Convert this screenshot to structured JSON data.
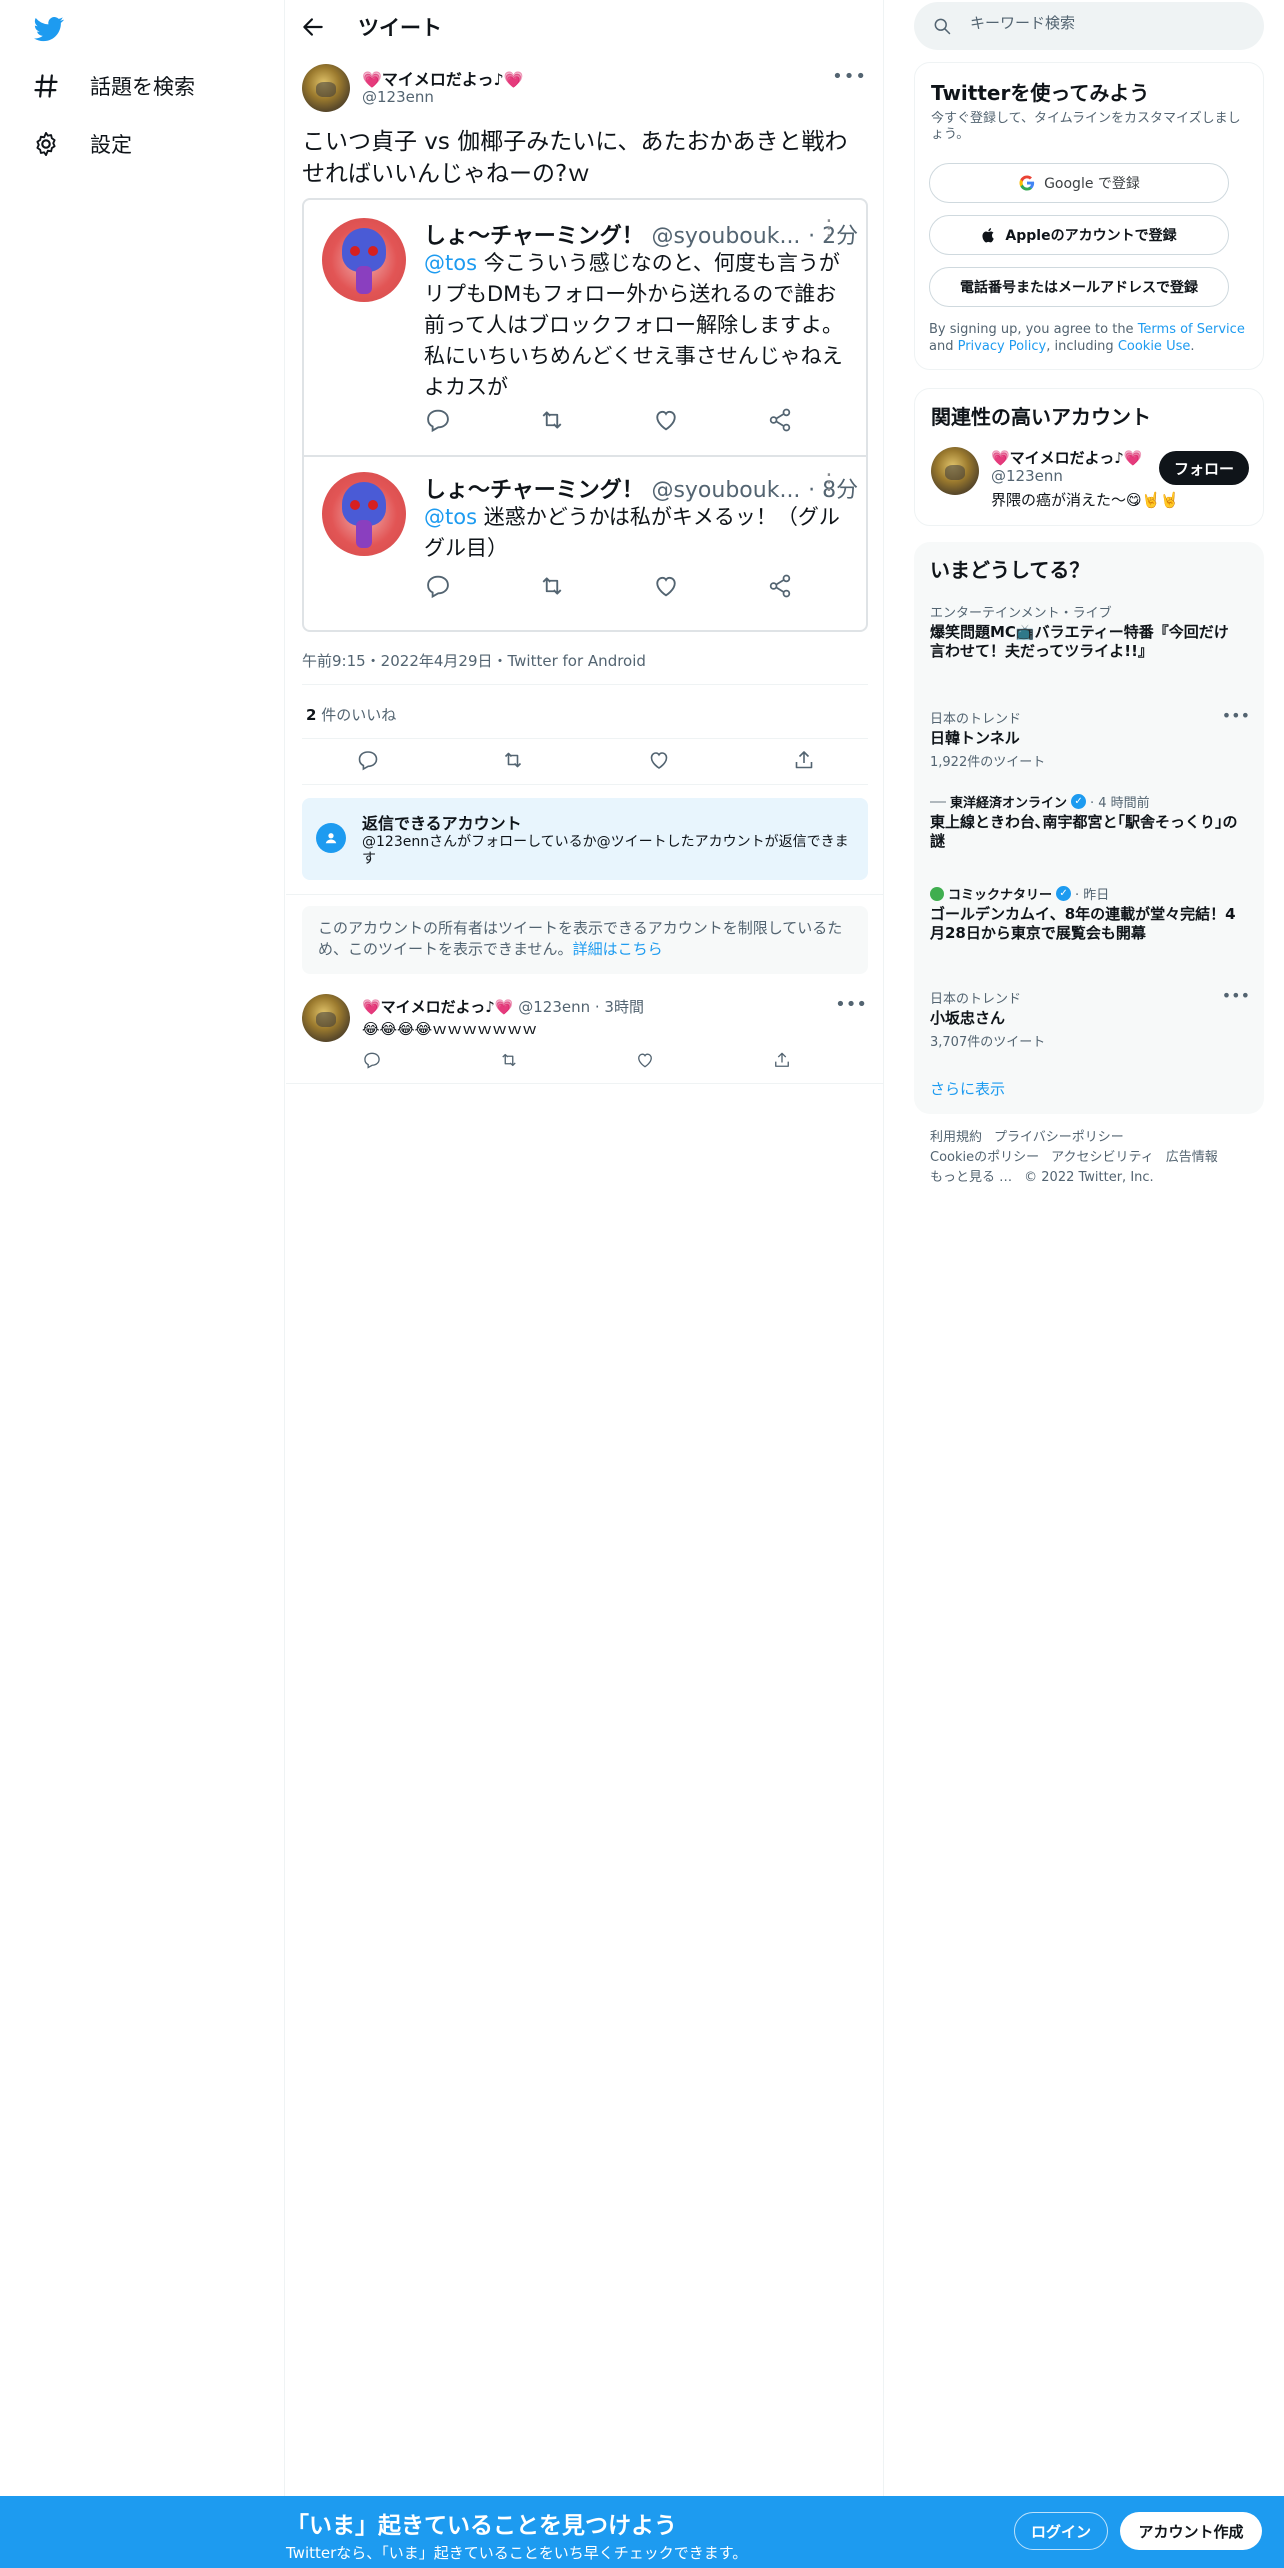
{
  "colors": {
    "accent": "#1d9bf0",
    "text": "#0f1419",
    "secondary": "#536471",
    "heart": "#e0245e"
  },
  "nav": {
    "items": [
      {
        "label": "話題を検索",
        "icon": "hashtag-icon"
      },
      {
        "label": "設定",
        "icon": "gear-icon"
      }
    ]
  },
  "header": {
    "title": "ツイート"
  },
  "tweet": {
    "author_name": "💗マイメロだよっ♪💗",
    "author_handle": "@123enn",
    "text": "こいつ貞子 vs 伽椰子みたいに、あたおかあきと戦わせればいいんじゃねーの?ｗ",
    "meta": "午前9:15・2022年4月29日・Twitter for Android",
    "likes_count": "2",
    "likes_label": " 件のいいね"
  },
  "embed": {
    "items": [
      {
        "name": "しょ〜チャーミング！",
        "handle": "@syoubouk...",
        "time": "· 2分",
        "mention": "@tos",
        "text": " 今こういう感じなのと、何度も言うがリプもDMもフォロー外から送れるので誰お前って人はブロックフォロー解除しますよ。私にいちいちめんどくせえ事させんじゃねえよカスが"
      },
      {
        "name": "しょ〜チャーミング！",
        "handle": "@syoubouk...",
        "time": "· 8分",
        "mention": "@tos",
        "text": " 迷惑かどうかは私がキメるッ！（グルグル目）"
      }
    ]
  },
  "reply_settings": {
    "title": "返信できるアカウント",
    "desc": "@123ennさんがフォローしているか@ツイートしたアカウントが返信できます"
  },
  "restricted": {
    "text": "このアカウントの所有者はツイートを表示できるアカウントを制限しているため、このツイートを表示できません。",
    "link": "詳細はこちら"
  },
  "reply": {
    "name": "💗マイメロだよっ♪💗",
    "handle_time": " @123enn · 3時間",
    "text": "😂😂😂😂ｗｗｗｗｗｗｗ"
  },
  "search": {
    "placeholder": "キーワード検索"
  },
  "signup": {
    "title": "Twitterを使ってみよう",
    "subtitle": "今すぐ登録して、タイムラインをカスタマイズしましょう。",
    "google": "Google で登録",
    "apple": "Appleのアカウントで登録",
    "phone": "電話番号またはメールアドレスで登録",
    "terms_1": "By signing up, you agree to the ",
    "terms_tos": "Terms of Service",
    "terms_2": " and ",
    "terms_privacy": "Privacy Policy",
    "terms_3": ", including ",
    "terms_cookie": "Cookie Use",
    "terms_4": "."
  },
  "related": {
    "title": "関連性の高いアカウント",
    "name": "💗マイメロだよっ♪💗",
    "handle": "@123enn",
    "bio": "界隈の癌が消えた〜😋🤘🤘",
    "follow": "フォロー"
  },
  "trends": {
    "title": "いまどうしてる？",
    "items": [
      {
        "category": "エンターテインメント・ライブ",
        "title": "爆笑問題MC📺バラエティー特番『今回だけ言わせて！夫だってツライよ!!』",
        "count": ""
      },
      {
        "category": "日本のトレンド",
        "title": "日韓トンネル",
        "count": "1,922件のツイート"
      },
      {
        "category": "東洋経済オンライン",
        "time": "· 4 時間前",
        "title": "東上線ときわ台､南宇都宮と｢駅舎そっくり｣の謎",
        "count": ""
      },
      {
        "category": "コミックナタリー",
        "time": "· 昨日",
        "title": "ゴールデンカムイ、8年の連載が堂々完結！4月28日から東京で展覧会も開幕",
        "count": ""
      },
      {
        "category": "日本のトレンド",
        "title": "小坂忠さん",
        "count": "3,707件のツイート"
      }
    ],
    "show_more": "さらに表示"
  },
  "footer": {
    "links": [
      "利用規約",
      "プライバシーポリシー",
      "Cookieのポリシー",
      "アクセシビリティ",
      "広告情報",
      "もっと見る …"
    ],
    "copyright": "© 2022 Twitter, Inc."
  },
  "bottom_bar": {
    "title": "「いま」起きていることを見つけよう",
    "subtitle": "Twitterなら、「いま」起きていることをいち早くチェックできます。",
    "login": "ログイン",
    "signup": "アカウント作成"
  }
}
